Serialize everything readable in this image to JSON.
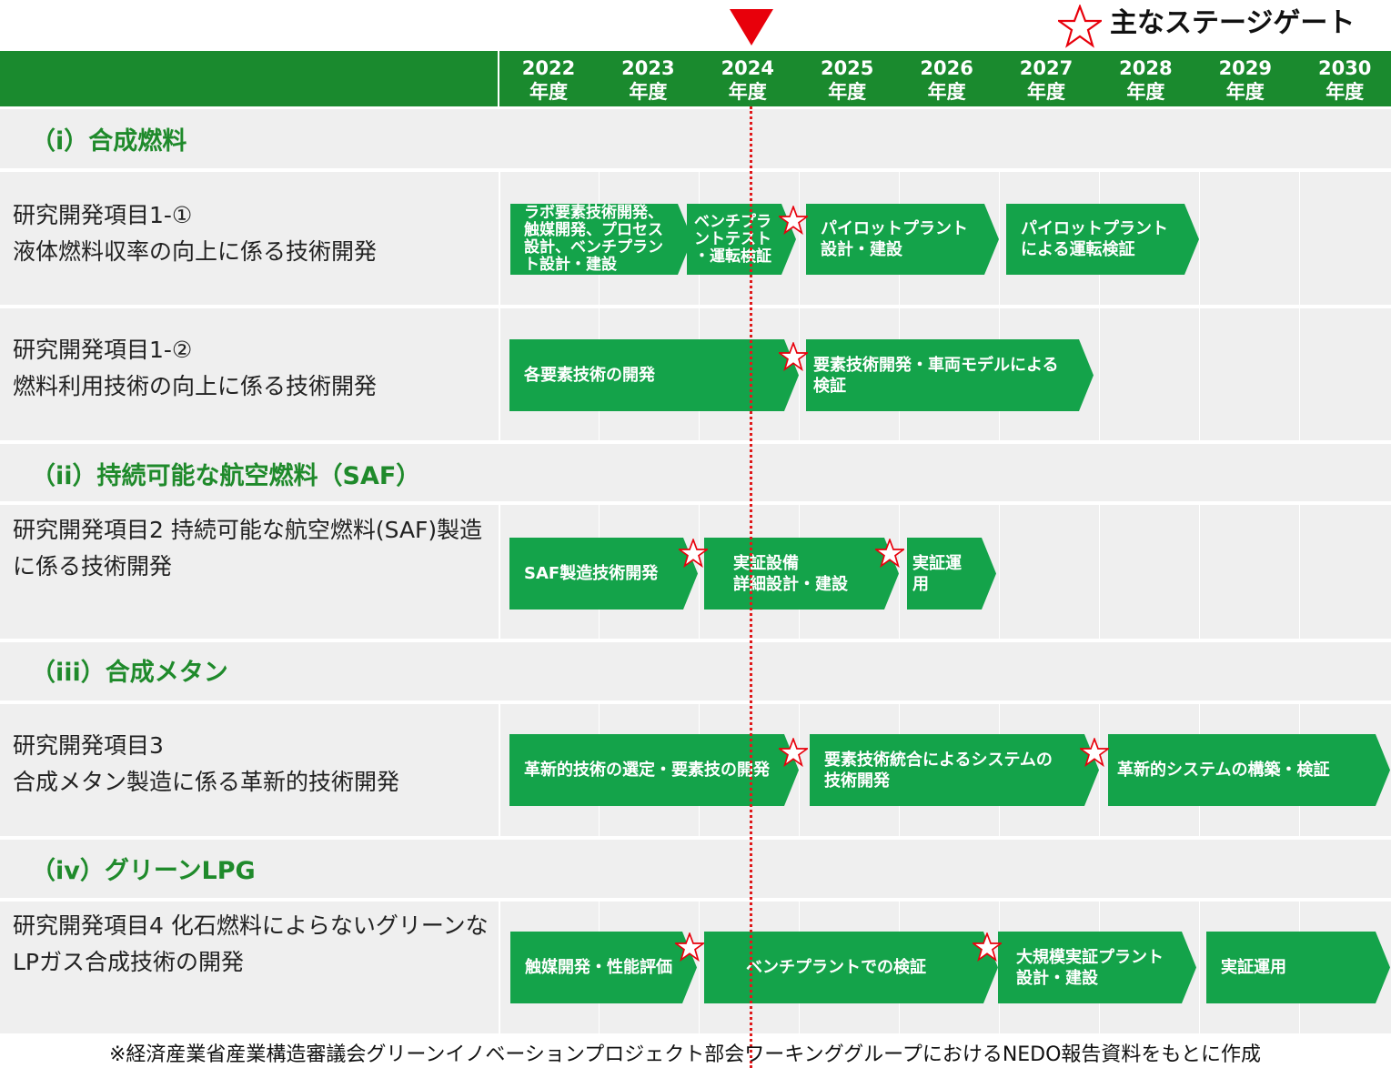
{
  "legend": {
    "label": "主なステージゲート",
    "icon": "star-outline-icon",
    "color": "#e8000b"
  },
  "current_year_marker": {
    "year": "2024",
    "color": "#e8000b"
  },
  "years": [
    "2022\n年度",
    "2023\n年度",
    "2024\n年度",
    "2025\n年度",
    "2026\n年度",
    "2027\n年度",
    "2028\n年度",
    "2029\n年度",
    "2030\n年度"
  ],
  "sections": {
    "s1": "（i）合成燃料",
    "s2": "（ii）持続可能な航空燃料（SAF）",
    "s3": "（iii）合成メタン",
    "s4": "（iv）グリーンLPG"
  },
  "rows": {
    "r1": "研究開発項目1-①\n液体燃料収率の向上に係る技術開発",
    "r2": "研究開発項目1-②\n燃料利用技術の向上に係る技術開発",
    "r3": "研究開発項目2\n持続可能な航空燃料(SAF)製造に係る技術開発",
    "r4": "研究開発項目3\n合成メタン製造に係る革新的技術開発",
    "r5": "研究開発項目4\n化石燃料によらないグリーンな LPガス合成技術の開発"
  },
  "tasks": {
    "t1a": "ラボ要素技術開発、\n触媒開発、プロセス\n設計、ベンチプラン\nト設計・建設",
    "t1b": "ベンチプラ\nントテスト\n・運転検証",
    "t1c": "パイロットプラント\n設計・建設",
    "t1d": "パイロットプラント\nによる運転検証",
    "t2a": "各要素技術の開発",
    "t2b": "要素技術開発・車両モデルによる\n検証",
    "t3a": "SAF製造技術開発",
    "t3b": "実証設備\n詳細設計・建設",
    "t3c": "実証運用",
    "t4a": "革新的技術の選定・要素技の開発",
    "t4b": "要素技術統合によるシステムの\n技術開発",
    "t4c": "革新的システムの構築・検証",
    "t5a": "触媒開発・性能評価",
    "t5b": "ベンチプラントでの検証",
    "t5c": "大規模実証プラント\n設計・建設",
    "t5d": "実証運用"
  },
  "colors": {
    "header": "#1a8a2e",
    "task": "#14a34a",
    "section_text": "#1f8a2b",
    "band": "#efefef"
  },
  "footnote": "※経済産業省産業構造審議会グリーンイノベーションプロジェクト部会ワーキンググループにおけるNEDO報告資料をもとに作成"
}
